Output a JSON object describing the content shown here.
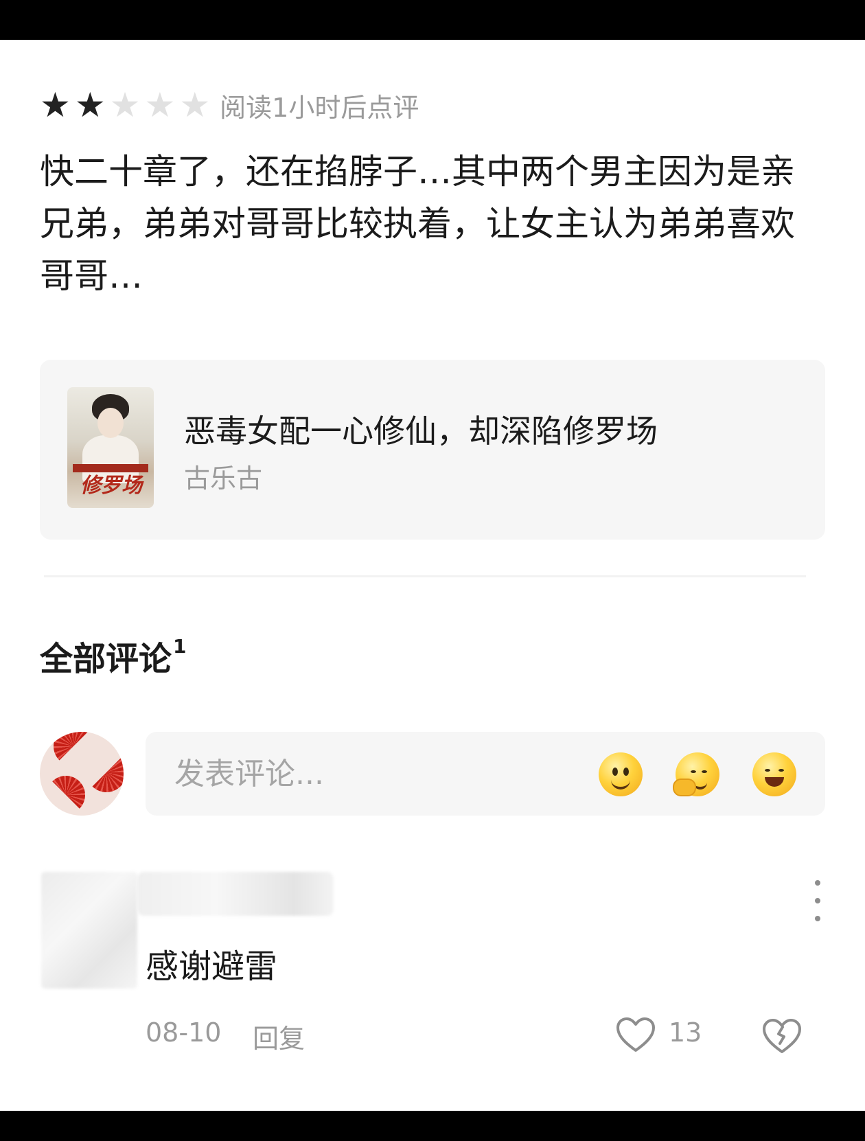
{
  "rating": {
    "value": 2,
    "max": 5,
    "note": "阅读1小时后点评"
  },
  "review": {
    "text": "快二十章了，还在掐脖子…其中两个男主因为是亲兄弟，弟弟对哥哥比较执着，让女主认为弟弟喜欢哥哥…"
  },
  "book": {
    "cover_icon": "book-cover-image",
    "cover_text": "修罗场",
    "title": "恶毒女配一心修仙，却深陷修罗场",
    "author": "古乐古"
  },
  "comments": {
    "heading": "全部评论",
    "count": "1",
    "input_placeholder": "发表评论...",
    "emoji_icons": [
      "smile-emoji-icon",
      "shy-emoji-icon",
      "grin-emoji-icon"
    ]
  },
  "comment_item": {
    "text": "感谢避雷",
    "date": "08-10",
    "reply_label": "回复",
    "like_count": "13",
    "more_icon": "more-vertical-icon",
    "like_icon": "heart-outline-icon",
    "dislike_icon": "broken-heart-icon"
  },
  "colors": {
    "text": "#1b1b1b",
    "muted": "#9a9a9a",
    "card": "#f6f6f6",
    "star_on": "#222222",
    "star_off": "#e1e1e1"
  }
}
